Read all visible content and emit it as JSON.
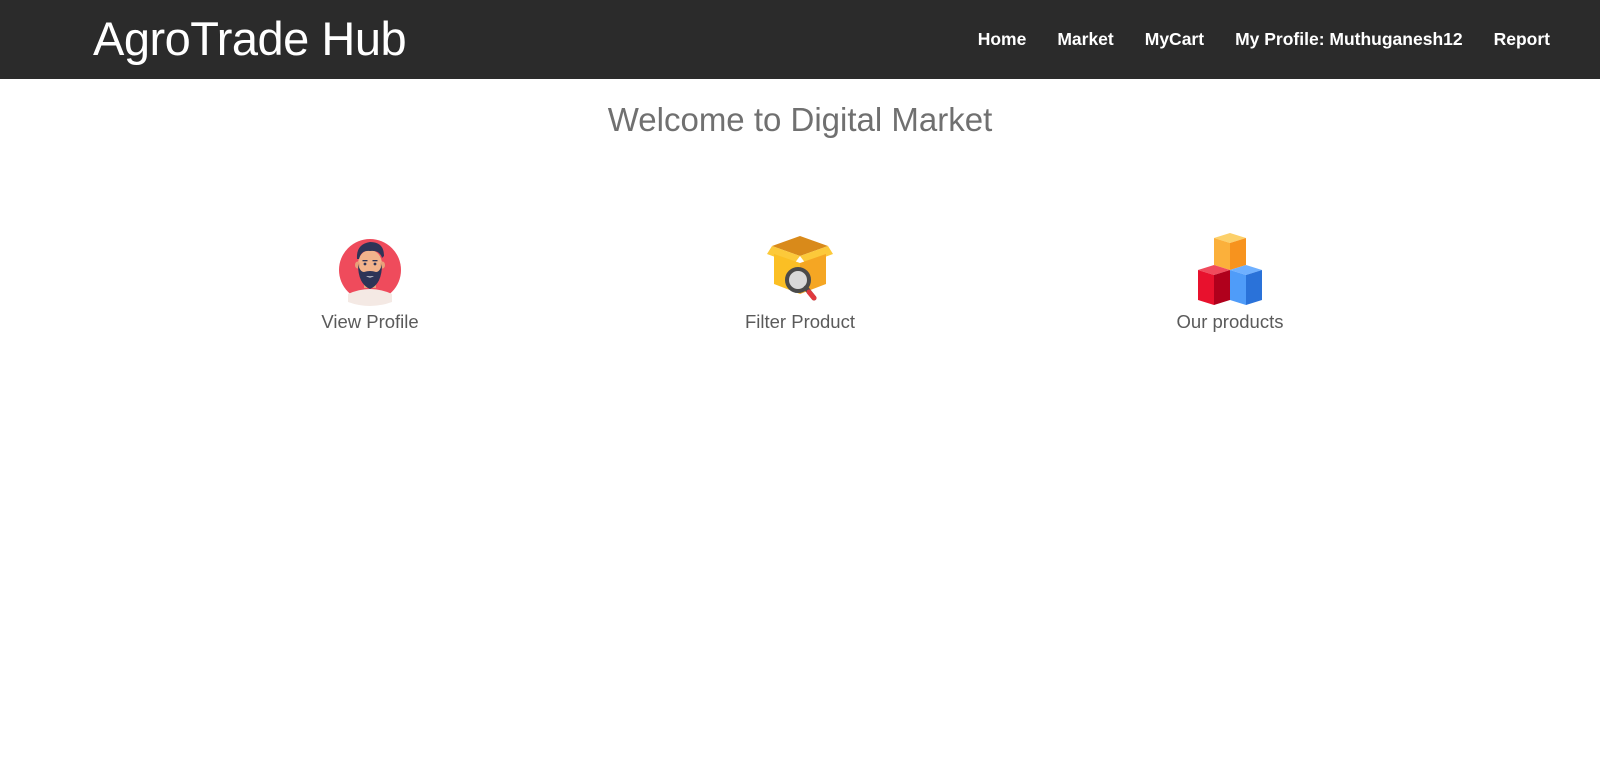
{
  "app": {
    "brand": "AgroTrade Hub"
  },
  "nav": {
    "items": [
      {
        "label": "Home",
        "name": "nav-home"
      },
      {
        "label": "Market",
        "name": "nav-market"
      },
      {
        "label": "MyCart",
        "name": "nav-mycart"
      },
      {
        "label": "My Profile: Muthuganesh12",
        "name": "nav-my-profile"
      },
      {
        "label": "Report",
        "name": "nav-report"
      }
    ]
  },
  "main": {
    "heading": "Welcome to Digital Market",
    "tiles": [
      {
        "label": "View Profile",
        "icon": "bearded-man-avatar-icon"
      },
      {
        "label": "Filter Product",
        "icon": "box-with-magnifier-icon"
      },
      {
        "label": "Our products",
        "icon": "stacked-cubes-icon"
      }
    ]
  },
  "colors": {
    "navbar_bg": "#2b2b2b",
    "nav_text": "#ffffff",
    "heading_text": "#707070",
    "tile_label": "#5a5a5a",
    "avatar_circle": "#ef4b5c",
    "box_yellow": "#fbbf24",
    "cube_red": "#e8112d",
    "cube_blue": "#3b8def",
    "cube_orange": "#fbb03b"
  }
}
